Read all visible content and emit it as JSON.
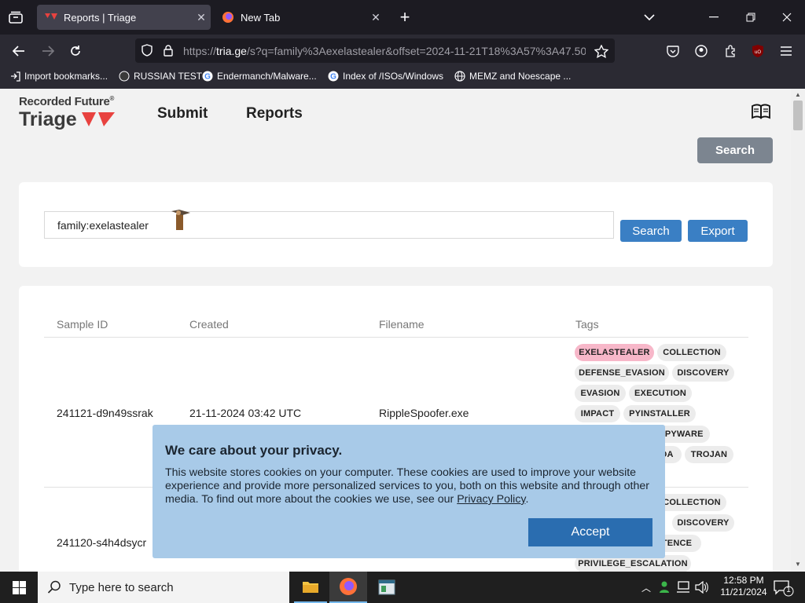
{
  "browser": {
    "tabs": [
      {
        "title": "Reports | Triage",
        "active": true
      },
      {
        "title": "New Tab",
        "active": false
      }
    ],
    "url": {
      "host": "tria.ge",
      "path": "/s?q=family%3Aexelastealer&offset=2024-11-21T18%3A57%3A47.50"
    },
    "bookmarks": [
      "Import bookmarks...",
      "RUSSIAN TEST",
      "Endermanch/Malware...",
      "Index of /ISOs/Windows",
      "MEMZ and Noescape ..."
    ]
  },
  "site": {
    "logo_top": "Recorded Future",
    "logo_reg": "®",
    "logo_bottom": "Triage",
    "nav": [
      "Submit",
      "Reports"
    ],
    "top_search_label": "Search"
  },
  "search": {
    "query": "family:exelastealer",
    "search_label": "Search",
    "export_label": "Export"
  },
  "results": {
    "columns": [
      "Sample ID",
      "Created",
      "Filename",
      "Tags"
    ],
    "rows": [
      {
        "sample_id": "241121-d9n49ssrak",
        "created": "21-11-2024 03:42 UTC",
        "filename": "RippleSpoofer.exe",
        "tags": [
          "EXELASTEALER",
          "COLLECTION",
          "DEFENSE_EVASION",
          "DISCOVERY",
          "EVASION",
          "EXECUTION",
          "IMPACT",
          "PYINSTALLER",
          "SPYWARE",
          "DA",
          "TROJAN"
        ]
      },
      {
        "sample_id": "241120-s4h4dsycr",
        "tags": [
          "COLLECTION",
          "DISCOVERY",
          "TENCE",
          "PRIVILEGE_ESCALATION"
        ]
      }
    ]
  },
  "cookie_banner": {
    "title": "We care about your privacy.",
    "text": "This website stores cookies on your computer. These cookies are used to improve your website experience and provide more personalized services to you, both on this website and through other media. To find out more about the cookies we use, see our ",
    "link": "Privacy Policy",
    "end": ".",
    "accept_label": "Accept"
  },
  "taskbar": {
    "search_placeholder": "Type here to search",
    "time": "12:58 PM",
    "date": "11/21/2024",
    "notification_count": "1"
  },
  "colors": {
    "accent": "#3a7fc4",
    "brand_red": "#e8423f",
    "tag_pink": "#f7b7c9",
    "cookie_bg": "#a8cae8"
  }
}
